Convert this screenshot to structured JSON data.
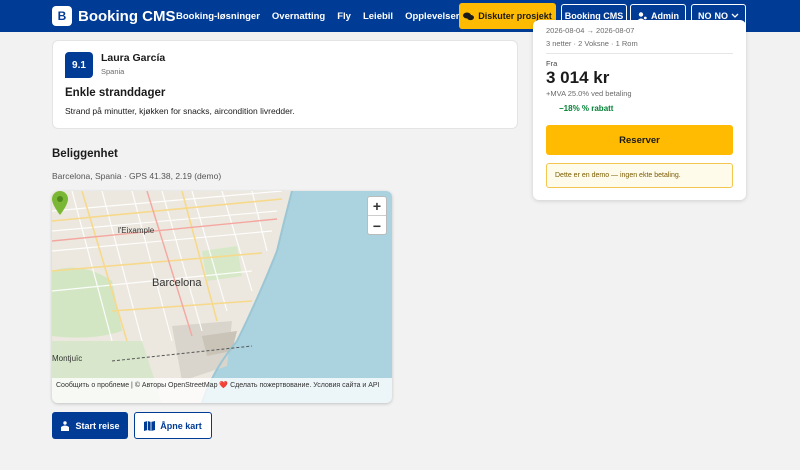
{
  "header": {
    "logo_letter": "B",
    "logo_text": "Booking CMS",
    "nav": [
      "Booking-løsninger",
      "Overnatting",
      "Fly",
      "Leiebil",
      "Opplevelser"
    ],
    "discuss_label": "Diskuter prosjekt",
    "cms_label": "Booking CMS",
    "admin_label": "Admin",
    "lang_code": "NO",
    "lang_label": "NO"
  },
  "review": {
    "score": "9.1",
    "name": "Laura García",
    "country": "Spania",
    "title": "Enkle stranddager",
    "text": "Strand på minutter, kjøkken for snacks, aircondition livredder."
  },
  "location": {
    "title": "Beliggenhet",
    "subtitle": "Barcelona, Spania · GPS 41.38, 2.19 (demo)"
  },
  "map": {
    "zoom_in": "+",
    "zoom_out": "−",
    "label_eixample": "l'Eixample",
    "label_barcelona": "Barcelona",
    "label_montjuic": "Montjuïc",
    "attribution": "Сообщить о проблеме | © Авторы OpenStreetMap ❤️ Сделать пожертвование. Условия сайта и API"
  },
  "actions": {
    "start_label": "Start reise",
    "open_map_label": "Åpne kart"
  },
  "booking": {
    "dates": "2026-08-04 → 2026-08-07",
    "meta": "3 netter · 2 Voksne · 1 Rom",
    "from_label": "Fra",
    "price": "3 014 kr",
    "vat": "+MVA 25.0% ved betaling",
    "discount": "−18% % rabatt",
    "reserve_label": "Reserver",
    "demo_note": "Dette er en demo — ingen ekte betaling."
  },
  "colors": {
    "brand": "#003b95",
    "accent": "#febb02",
    "discount": "#008234"
  }
}
